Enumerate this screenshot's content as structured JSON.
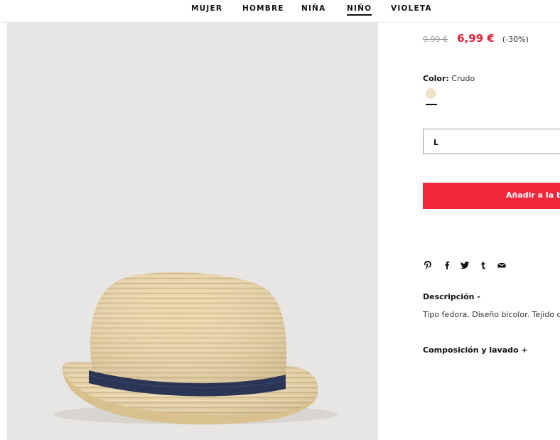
{
  "nav": {
    "items": [
      {
        "label": "MUJER",
        "active": false
      },
      {
        "label": "HOMBRE",
        "active": false
      },
      {
        "label": "NIÑA",
        "active": false
      },
      {
        "label": "NIÑO",
        "active": true
      },
      {
        "label": "VIOLETA",
        "active": false
      }
    ]
  },
  "product": {
    "image_alt": "Tipo fedora",
    "old_price": "9,99 €",
    "price": "6,99 €",
    "discount": "(-30%)",
    "color_label": "Color:",
    "color_value": "Crudo",
    "swatch_color": "#f0e3c7",
    "size_selected": "L",
    "add_button_label": "Añadir a la bo",
    "share_icons": [
      "pinterest-icon",
      "facebook-icon",
      "twitter-icon",
      "tumblr-icon",
      "email-icon"
    ],
    "description_title": "Descripción -",
    "description_text": "Tipo fedora. Diseño bicolor. Tejido de",
    "composition_title": "Composición y lavado +"
  },
  "colors": {
    "accent_red": "#f2263a",
    "sale_red": "#e11d31",
    "image_bg": "#e8e6e4"
  }
}
